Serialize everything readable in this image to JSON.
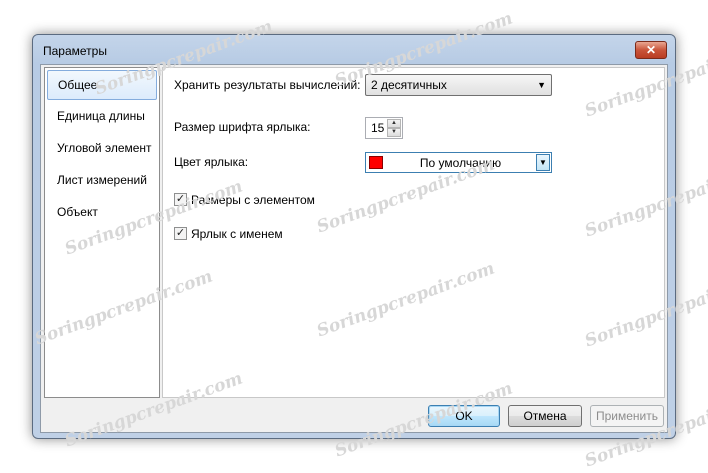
{
  "window": {
    "title": "Параметры",
    "close_glyph": "✕"
  },
  "sidebar": {
    "items": [
      {
        "label": "Общее",
        "selected": true
      },
      {
        "label": "Единица длины",
        "selected": false
      },
      {
        "label": "Угловой элемент",
        "selected": false
      },
      {
        "label": "Лист измерений",
        "selected": false
      },
      {
        "label": "Объект",
        "selected": false
      }
    ]
  },
  "general": {
    "precision_label": "Хранить результаты вычислений:",
    "precision_value": "2 десятичных",
    "font_size_label": "Размер шрифта ярлыка:",
    "font_size_value": "15",
    "label_color_label": "Цвет ярлыка:",
    "label_color_value": "По умолчанию",
    "label_color_swatch": "#ff0000",
    "dims_with_element_label": "Размеры с элементом",
    "dims_with_element_checked": true,
    "label_with_name_label": "Ярлык с именем",
    "label_with_name_checked": true
  },
  "buttons": {
    "ok": "OK",
    "cancel": "Отмена",
    "apply": "Применить"
  },
  "watermark": "Soringpcrepair.com",
  "icons": {
    "dropdown": "triangle-down-icon",
    "check": "checkmark-icon",
    "close": "close-icon"
  },
  "colors": {
    "accent": "#3c7fb1",
    "titlebar": "#b9cce4",
    "close": "#c9553a"
  }
}
